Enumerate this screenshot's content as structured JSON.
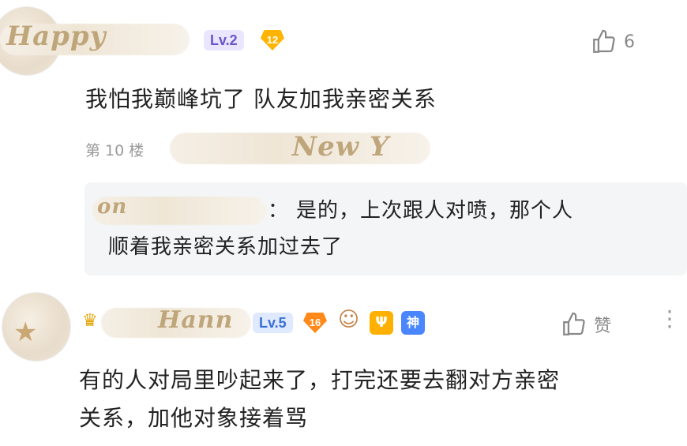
{
  "comment1": {
    "username_visible": "Happy",
    "level": "Lv.2",
    "gem_number": "12",
    "like_count": "6",
    "text": "我怕我巅峰坑了 队友加我亲密关系"
  },
  "reply": {
    "floor": "第 10 楼",
    "floor_username_visible": "New Y",
    "reply_username_visible": "on",
    "colon": "：",
    "line1": "是的，上次跟人对喷，那个人",
    "line2": "顺着我亲密关系加过去了"
  },
  "comment2": {
    "username_visible": "Hann",
    "level": "Lv.5",
    "gem_number": "16",
    "like_label": "赞",
    "badge_psi": "Ψ",
    "badge_god": "神",
    "line1": "有的人对局里吵起来了，打完还要去翻对方亲密",
    "line2": "关系，加他对象接着骂"
  },
  "colors": {
    "lv2_bg": "#ebe6ff",
    "lv5_bg": "#dfeaff",
    "gem": "#ffb400",
    "reply_bg": "#f4f5f7"
  }
}
